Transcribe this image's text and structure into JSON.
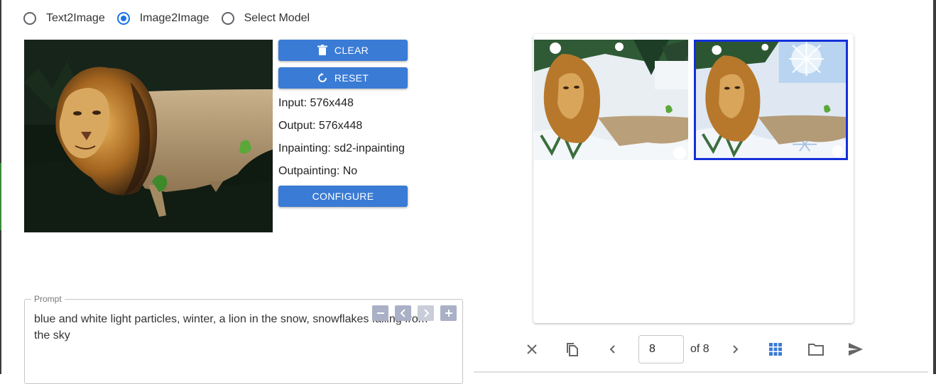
{
  "mode_selector": {
    "options": [
      {
        "label": "Text2Image",
        "checked": false
      },
      {
        "label": "Image2Image",
        "checked": true
      },
      {
        "label": "Select Model",
        "checked": false
      }
    ]
  },
  "actions": {
    "clear_label": "CLEAR",
    "reset_label": "RESET",
    "configure_label": "CONFIGURE"
  },
  "info": {
    "input": "Input: 576x448",
    "output": "Output: 576x448",
    "inpainting": "Inpainting: sd2-inpainting",
    "outpainting": "Outpainting: No"
  },
  "prompt": {
    "legend": "Prompt",
    "text": "blue and white light particles, winter, a lion in the snow, snowflakes falling from the sky",
    "controls": [
      "minus-icon",
      "chevron-left-icon",
      "chevron-right-icon",
      "plus-icon"
    ]
  },
  "gallery": {
    "images": [
      "lion-in-snow-1",
      "lion-in-snow-2"
    ],
    "selected_index": 1
  },
  "pager": {
    "current": "8",
    "of_label": "of 8"
  },
  "colors": {
    "accent": "#3a7bd5",
    "radio_selected": "#1a73e8",
    "selection_border": "#1430d8"
  },
  "icons": {
    "close": "close-icon",
    "copy": "copy-icon",
    "prev": "chevron-left-icon",
    "next": "chevron-right-icon",
    "grid": "grid-icon",
    "folder": "folder-icon",
    "send": "send-icon"
  }
}
